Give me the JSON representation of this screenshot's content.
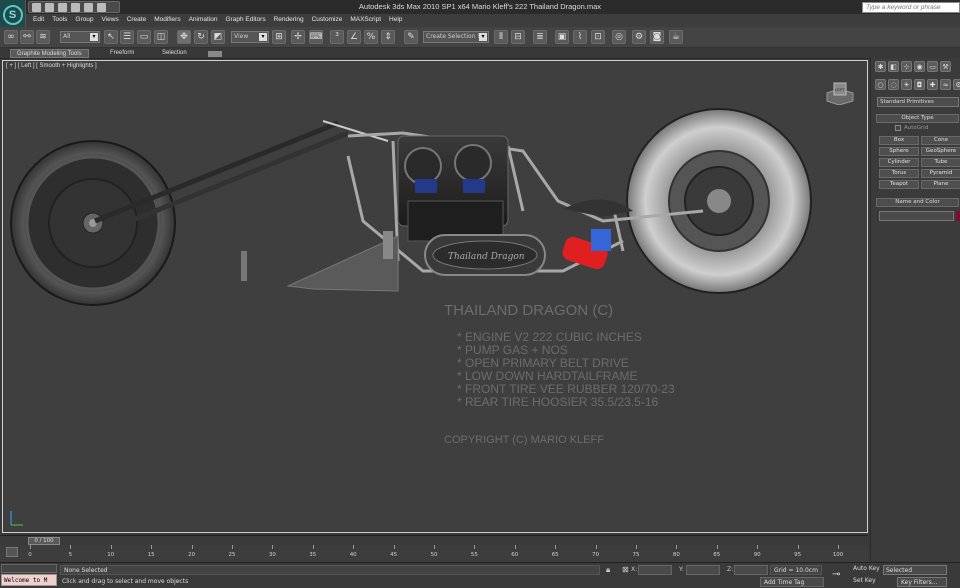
{
  "titlebar": {
    "title": "Autodesk 3ds Max  2010 SP1 x64      Mario Kleff's 222 Thailand Dragon.max",
    "logo_glyph": "S",
    "search_placeholder": "Type a keyword or phrase"
  },
  "menu": [
    "Edit",
    "Tools",
    "Group",
    "Views",
    "Create",
    "Modifiers",
    "Animation",
    "Graph Editors",
    "Rendering",
    "Customize",
    "MAXScript",
    "Help"
  ],
  "toolbar": {
    "filter_value": "All",
    "refcoord_value": "View",
    "named_selection_value": "Create Selection Se"
  },
  "ribbon": {
    "tabs": [
      "Graphite Modeling Tools",
      "Freeform",
      "Selection"
    ]
  },
  "viewport": {
    "label": "[ + ] [ Left ] [ Smooth + Highlights ]",
    "viewcube_label": "LEFT",
    "spec_title": "THAILAND DRAGON (C)",
    "spec_lines": [
      "* ENGINE V2 222 CUBIC INCHES",
      "* PUMP GAS + NOS",
      "* OPEN PRIMARY BELT DRIVE",
      "* LOW DOWN HARDTAILFRAME",
      "* FRONT TIRE VEE RUBBER 120/70-23",
      "* REAR TIRE HOOSIER 35.5/23.5-16"
    ],
    "copyright": "COPYRIGHT (C) MARIO KLEFF",
    "engine_badge": "Thailand Dragon"
  },
  "command_panel": {
    "primitives_value": "Standard Primitives",
    "object_type_title": "Object Type",
    "autogrid_label": "AutoGrid",
    "objects": [
      "Box",
      "Cone",
      "Sphere",
      "GeoSphere",
      "Cylinder",
      "Tube",
      "Torus",
      "Pyramid",
      "Teapot",
      "Plane"
    ],
    "name_color_title": "Name and Color"
  },
  "timeline": {
    "frame_display": "0 / 100",
    "ticks": [
      "0",
      "5",
      "10",
      "15",
      "20",
      "25",
      "30",
      "35",
      "40",
      "45",
      "50",
      "55",
      "60",
      "65",
      "70",
      "75",
      "80",
      "85",
      "90",
      "95",
      "100"
    ]
  },
  "status": {
    "listener_text": "Welcome to M",
    "selection_text": "None Selected",
    "prompt_text": "Click and drag to select and move objects",
    "x_label": "X:",
    "y_label": "Y:",
    "z_label": "Z:",
    "grid_text": "Grid = 10.0cm",
    "add_time_tag": "Add Time Tag",
    "auto_key": "Auto Key",
    "set_key": "Set Key",
    "key_mode_value": "Selected",
    "key_filters": "Key Filters..."
  }
}
